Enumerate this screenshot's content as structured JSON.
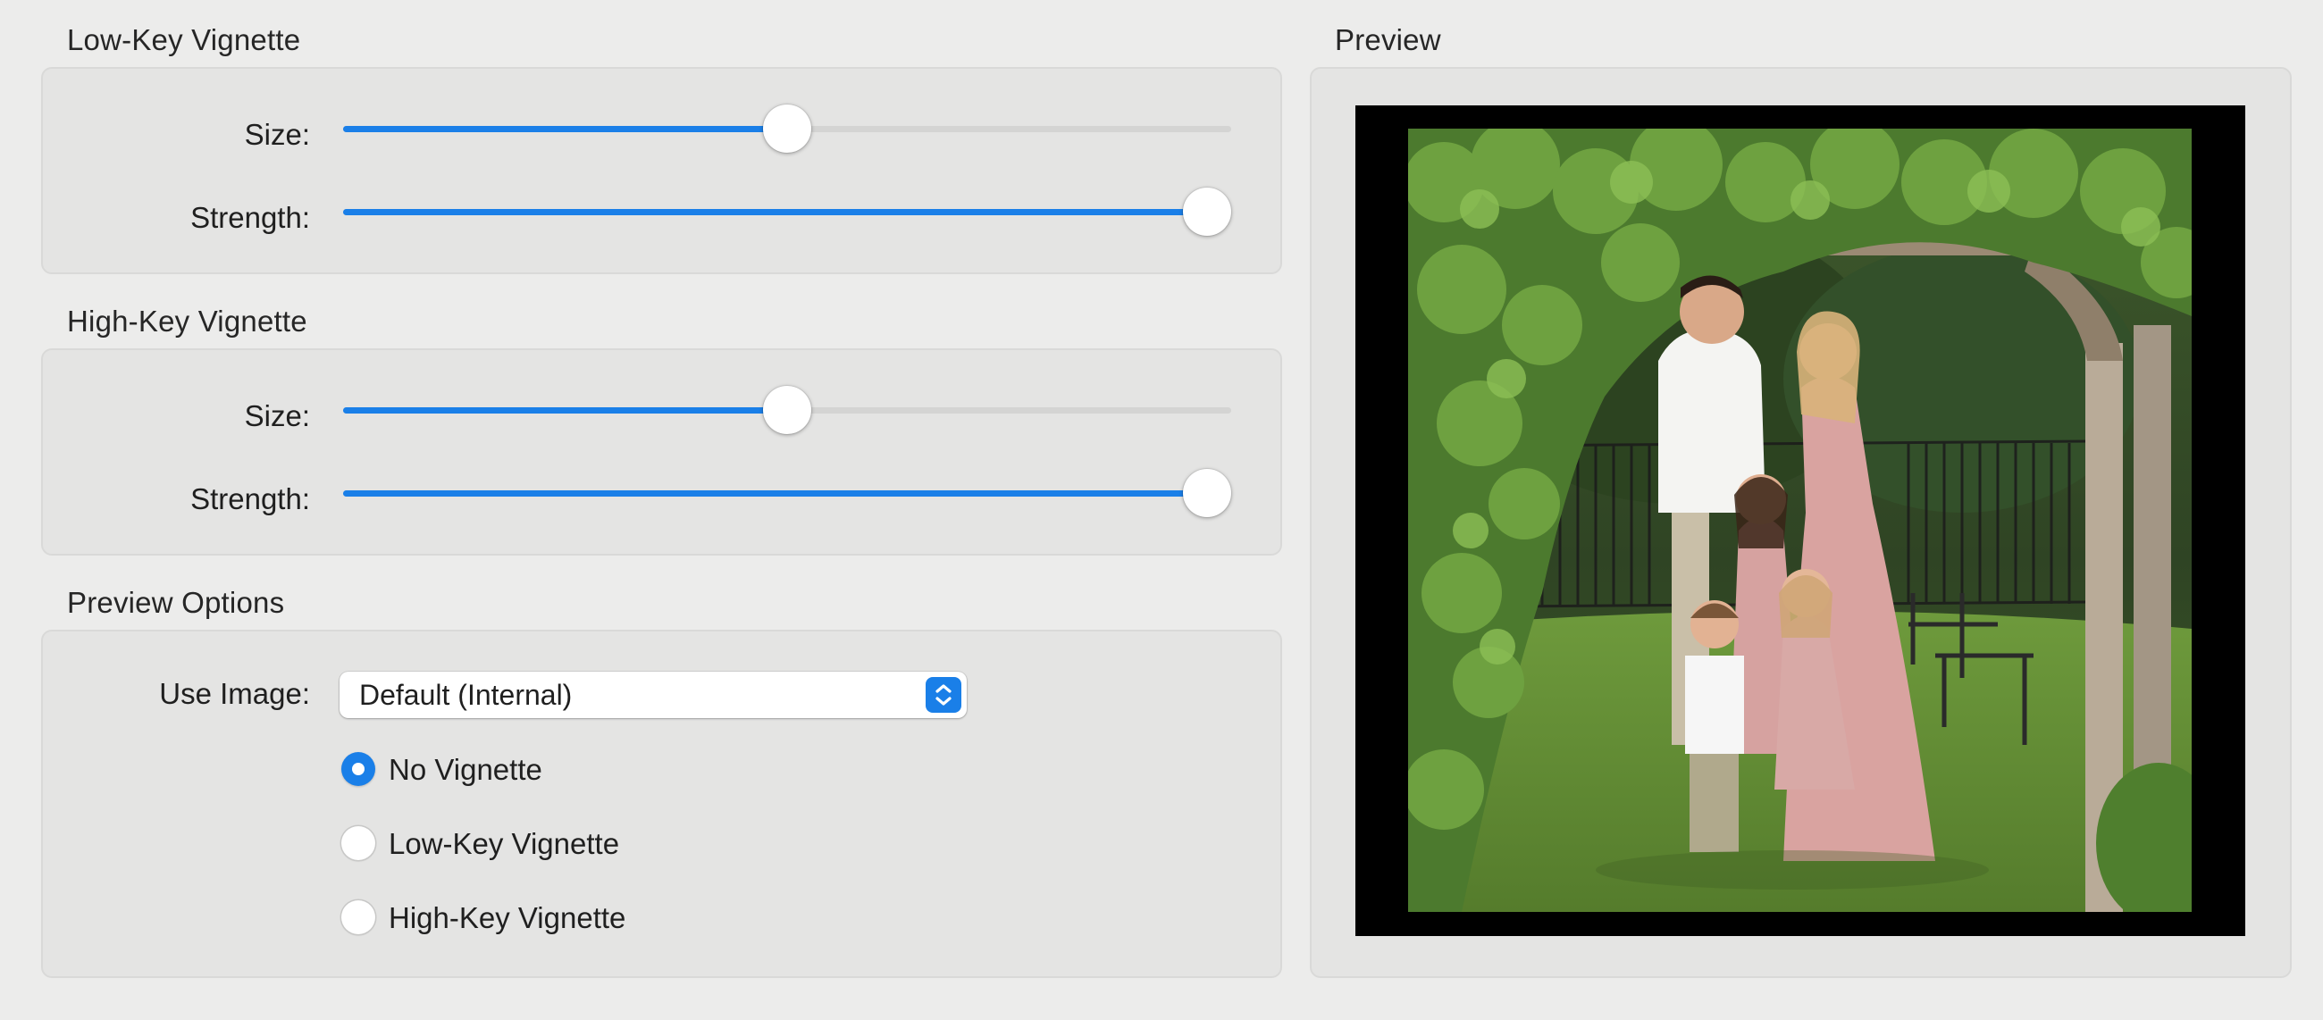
{
  "low_key": {
    "title": "Low-Key Vignette",
    "size_label": "Size:",
    "size_value": 0.5,
    "strength_label": "Strength:",
    "strength_value": 1.0
  },
  "high_key": {
    "title": "High-Key Vignette",
    "size_label": "Size:",
    "size_value": 0.5,
    "strength_label": "Strength:",
    "strength_value": 1.0
  },
  "preview_options": {
    "title": "Preview Options",
    "use_image_label": "Use Image:",
    "use_image_value": "Default (Internal)",
    "radio_options": [
      {
        "label": "No Vignette",
        "selected": true
      },
      {
        "label": "Low-Key Vignette",
        "selected": false
      },
      {
        "label": "High-Key Vignette",
        "selected": false
      }
    ]
  },
  "preview": {
    "title": "Preview",
    "image": "family-portrait-photo"
  },
  "colors": {
    "accent": "#1a7fe8",
    "background": "#ececeb",
    "group_box": "#e4e4e3"
  }
}
